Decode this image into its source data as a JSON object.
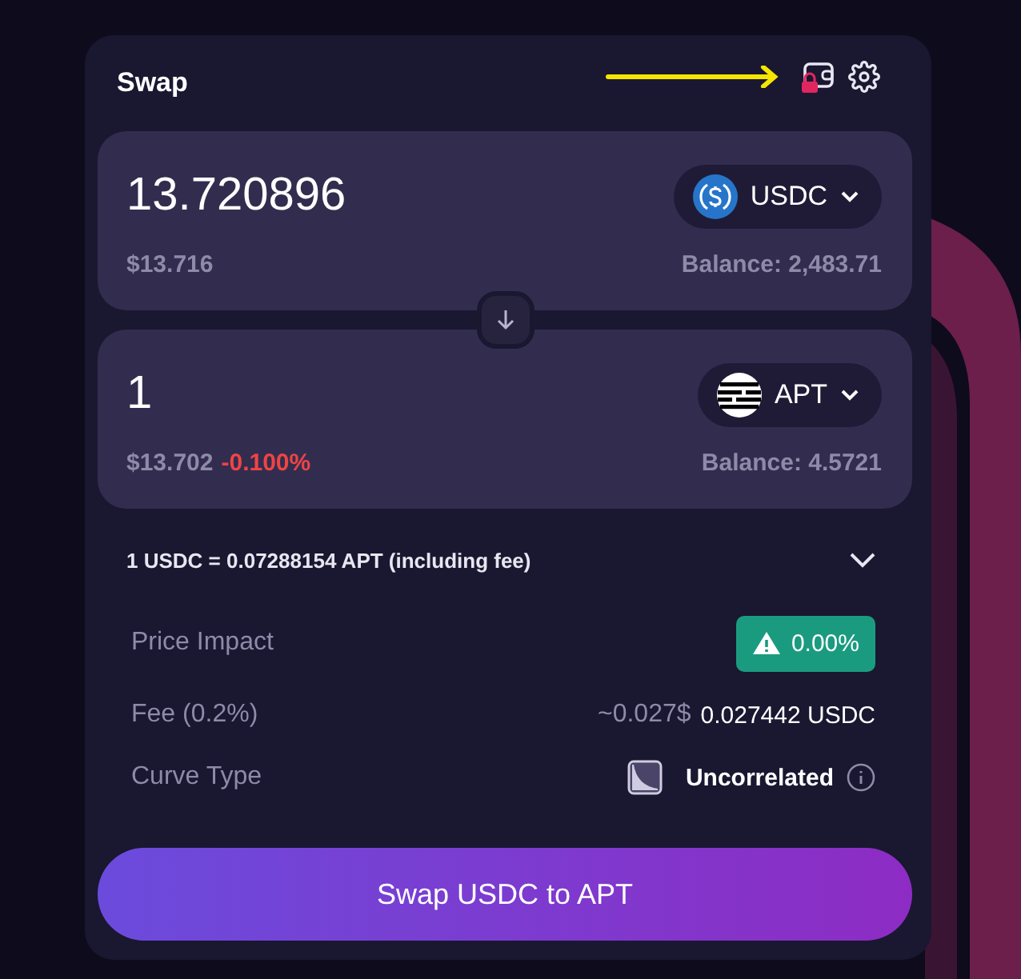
{
  "header": {
    "title": "Swap"
  },
  "panels": [
    {
      "amount": "13.720896",
      "token": "USDC",
      "kind": "usdc",
      "usd": "$13.716",
      "balance": "Balance: 2,483.71"
    },
    {
      "amount": "1",
      "token": "APT",
      "kind": "apt",
      "usd": "$13.702",
      "change": "-0.100%",
      "balance": "Balance: 4.5721"
    }
  ],
  "rate": {
    "text": "1 USDC = 0.07288154 APT (including fee)",
    "expanded": false
  },
  "details": [
    {
      "kind": "badge",
      "label": "Price Impact",
      "value": "0.00%"
    },
    {
      "kind": "fee",
      "label": "Fee (0.2%)",
      "approx": "~0.027$",
      "value": "0.027442 USDC"
    },
    {
      "kind": "curve",
      "label": "Curve Type",
      "value": "Uncorrelated"
    }
  ],
  "button": "Swap USDC to APT"
}
